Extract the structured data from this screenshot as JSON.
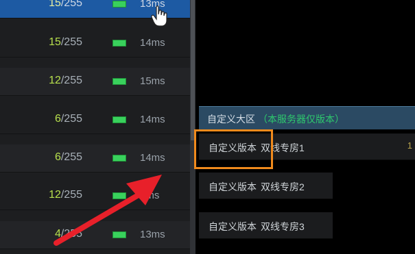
{
  "server_list": {
    "rows": [
      {
        "current": "15",
        "max": "/255",
        "ping": "13ms",
        "selected": true
      },
      {
        "current": "15",
        "max": "/255",
        "ping": "14ms"
      },
      {
        "current": "12",
        "max": "/255",
        "ping": "15ms"
      },
      {
        "current": "6",
        "max": "/255",
        "ping": "14ms"
      },
      {
        "current": "6",
        "max": "/255",
        "ping": "14ms"
      },
      {
        "current": "12",
        "max": "/255",
        "ping": "9ms"
      },
      {
        "current": "4",
        "max": "/255",
        "ping": "13ms"
      }
    ]
  },
  "region_panel": {
    "title": "自定义大区",
    "note": "（本服务器仅版本）",
    "versions": [
      {
        "label": "自定义版本",
        "room": "双线专房1"
      },
      {
        "label": "自定义版本",
        "room": "双线专房2"
      },
      {
        "label": "自定义版本",
        "room": "双线专房3"
      }
    ]
  },
  "colors": {
    "selected_row": "#1d5aa3",
    "player_count": "#b7e04d",
    "signal": "#39d15c",
    "region_note": "#2ec86d",
    "highlight_box": "#f08a1c",
    "annotation_arrow": "#e8202a"
  },
  "icons": {
    "signal": "signal-strength-icon",
    "cursor": "hand-pointer-icon",
    "annotation": "red-arrow-icon"
  }
}
